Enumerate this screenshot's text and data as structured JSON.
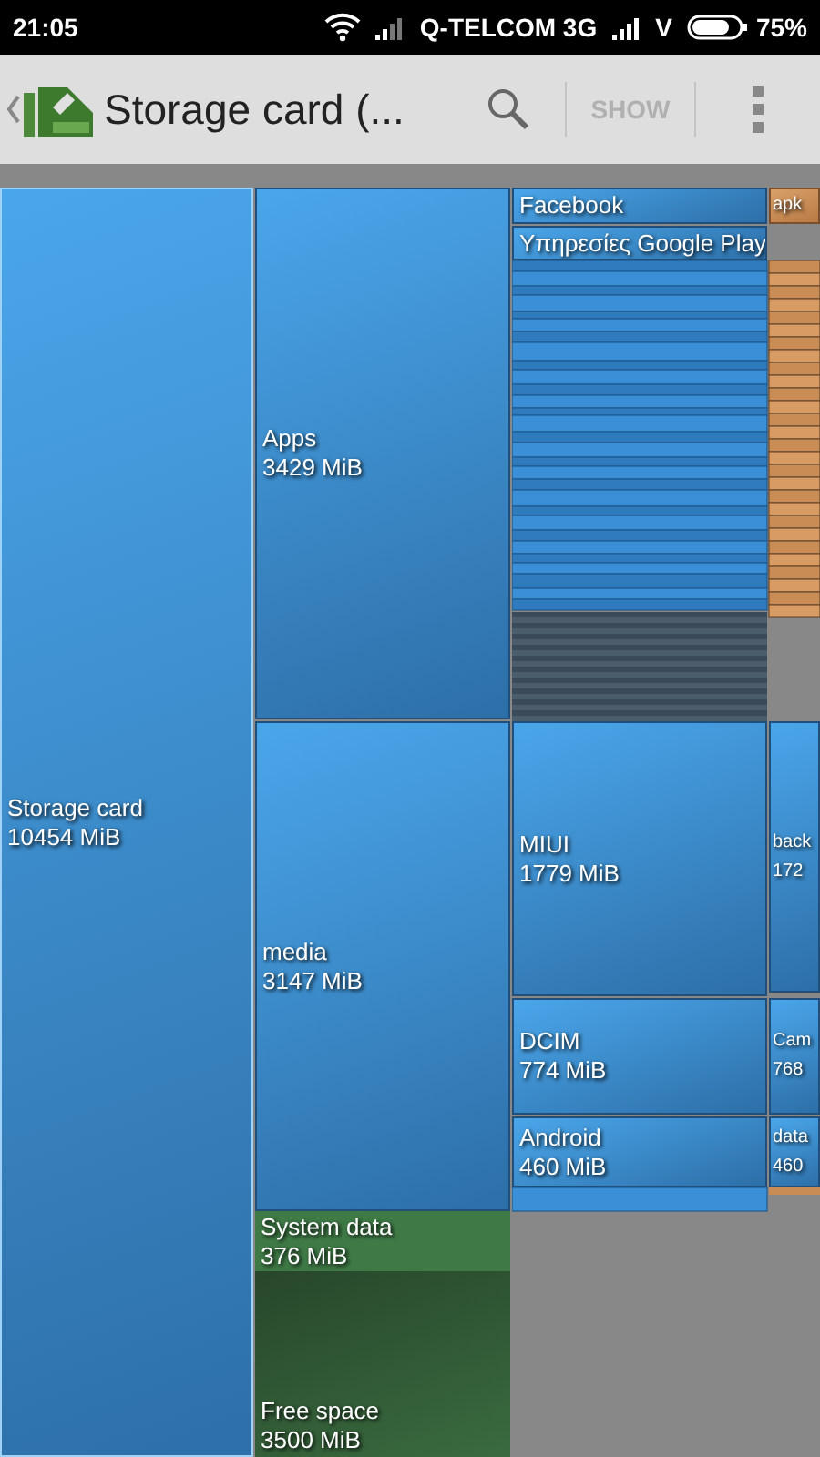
{
  "status_bar": {
    "time": "21:05",
    "carrier": "Q-TELCOM 3G",
    "network": "V",
    "battery": "75%"
  },
  "action_bar": {
    "title": "Storage card (...",
    "show_button": "SHOW"
  },
  "tiles": [
    {
      "kind": "folder",
      "name": "Storage card",
      "size": "10454 MiB"
    },
    {
      "kind": "folder",
      "name": "Apps",
      "size": "3429 MiB"
    },
    {
      "kind": "folder",
      "name": "media",
      "size": "3147 MiB"
    },
    {
      "kind": "system",
      "name": "System data",
      "size": "376 MiB"
    },
    {
      "kind": "free",
      "name": "Free space",
      "size": "3500 MiB"
    },
    {
      "kind": "folder",
      "name": "Facebook"
    },
    {
      "kind": "folder",
      "name": "Υπηρεσίες Google Play"
    },
    {
      "kind": "apk",
      "name": "apk"
    },
    {
      "kind": "folder",
      "name": "MIUI",
      "size": "1779 MiB"
    },
    {
      "kind": "folder",
      "name": "DCIM",
      "size": "774 MiB"
    },
    {
      "kind": "folder",
      "name": "Android",
      "size": "460 MiB"
    },
    {
      "kind": "folder",
      "name": "back",
      "size": "172"
    },
    {
      "kind": "folder",
      "name": "Cam",
      "size": "768"
    },
    {
      "kind": "folder",
      "name": "data",
      "size": "460"
    }
  ]
}
